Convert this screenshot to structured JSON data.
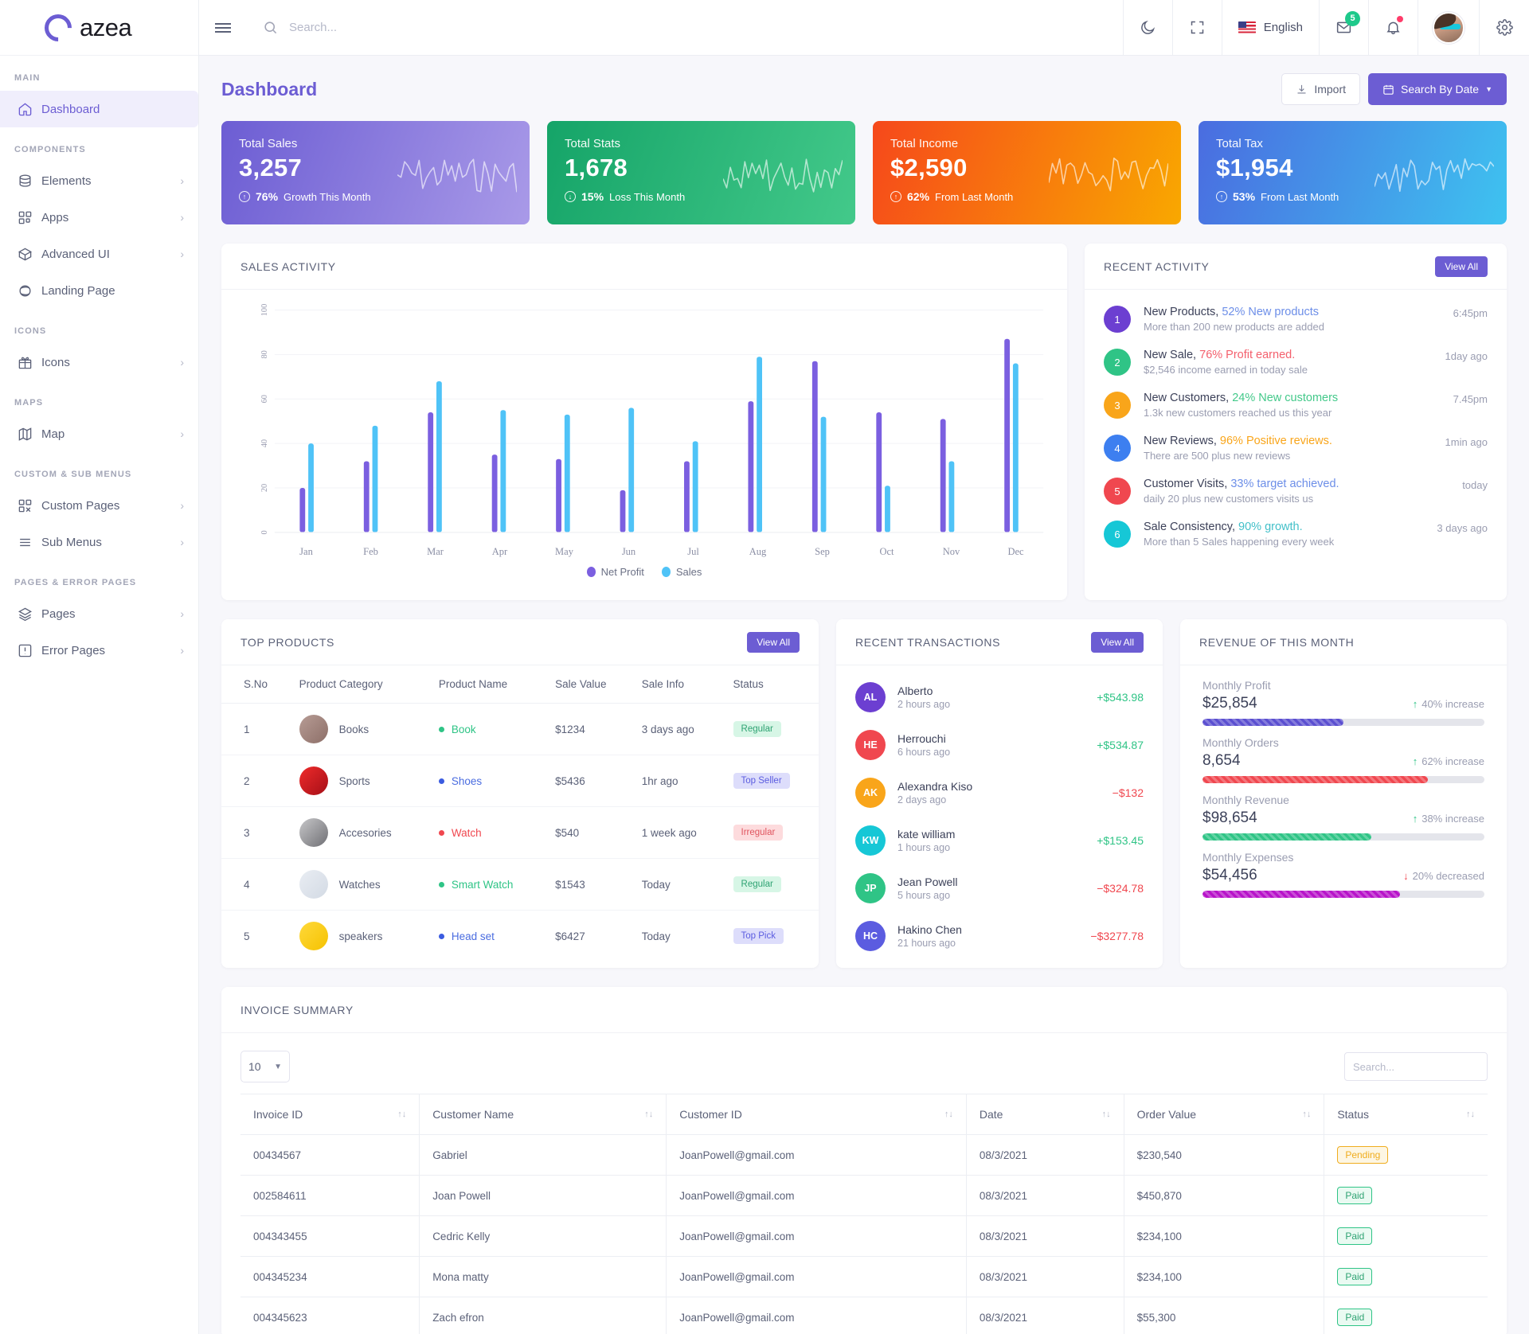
{
  "brand": {
    "name": "azea",
    "logo_icon": "azea-ring-logo"
  },
  "sidebar": {
    "sections": [
      {
        "title": "MAIN",
        "items": [
          {
            "label": "Dashboard",
            "icon": "home-icon",
            "active": true,
            "chevron": false
          }
        ]
      },
      {
        "title": "COMPONENTS",
        "items": [
          {
            "label": "Elements",
            "icon": "database-icon",
            "chevron": true
          },
          {
            "label": "Apps",
            "icon": "grid-icon",
            "chevron": true
          },
          {
            "label": "Advanced UI",
            "icon": "box-icon",
            "chevron": true
          },
          {
            "label": "Landing Page",
            "icon": "planet-icon",
            "chevron": false
          }
        ]
      },
      {
        "title": "ICONS",
        "items": [
          {
            "label": "Icons",
            "icon": "gift-icon",
            "chevron": true
          }
        ]
      },
      {
        "title": "MAPS",
        "items": [
          {
            "label": "Map",
            "icon": "map-icon",
            "chevron": true
          }
        ]
      },
      {
        "title": "CUSTOM & SUB MENUS",
        "items": [
          {
            "label": "Custom Pages",
            "icon": "custom-grid-icon",
            "chevron": true
          },
          {
            "label": "Sub Menus",
            "icon": "list-icon",
            "chevron": true
          }
        ]
      },
      {
        "title": "PAGES & ERROR PAGES",
        "items": [
          {
            "label": "Pages",
            "icon": "layers-icon",
            "chevron": true
          },
          {
            "label": "Error Pages",
            "icon": "alert-icon",
            "chevron": true
          }
        ]
      }
    ]
  },
  "topbar": {
    "search_placeholder": "Search...",
    "language": "English",
    "mail_badge": "5",
    "icons": [
      "moon-icon",
      "fullscreen-icon",
      "us-flag-icon",
      "mail-icon",
      "bell-icon",
      "avatar",
      "gear-icon"
    ]
  },
  "page": {
    "title": "Dashboard",
    "import_label": "Import",
    "search_by_date_label": "Search By Date"
  },
  "stats": [
    {
      "title": "Total Sales",
      "value": "3,257",
      "pct": "76%",
      "note": "Growth This Month",
      "dir": "up",
      "c1": "#6c5dd3",
      "c2": "#a99ae8"
    },
    {
      "title": "Total Stats",
      "value": "1,678",
      "pct": "15%",
      "note": "Loss This Month",
      "dir": "down",
      "c1": "#15a468",
      "c2": "#43c98a"
    },
    {
      "title": "Total Income",
      "value": "$2,590",
      "pct": "62%",
      "note": "From Last Month",
      "dir": "up",
      "c1": "#f6481b",
      "c2": "#f9a800"
    },
    {
      "title": "Total Tax",
      "value": "$1,954",
      "pct": "53%",
      "note": "From Last Month",
      "dir": "up",
      "c1": "#4a6ce0",
      "c2": "#3ec3f0"
    }
  ],
  "sales_activity": {
    "title": "SALES ACTIVITY"
  },
  "chart_data": {
    "type": "bar",
    "title": "SALES ACTIVITY",
    "categories": [
      "Jan",
      "Feb",
      "Mar",
      "Apr",
      "May",
      "Jun",
      "Jul",
      "Aug",
      "Sep",
      "Oct",
      "Nov",
      "Dec"
    ],
    "series": [
      {
        "name": "Net Profit",
        "color": "#7b5fe0",
        "values": [
          20,
          32,
          54,
          35,
          33,
          19,
          32,
          59,
          77,
          54,
          51,
          87
        ]
      },
      {
        "name": "Sales",
        "color": "#4fc3f7",
        "values": [
          40,
          48,
          68,
          55,
          53,
          56,
          41,
          79,
          52,
          21,
          32,
          76
        ]
      }
    ],
    "xlabel": "",
    "ylabel": "",
    "ylim": [
      0,
      100
    ],
    "yticks": [
      0,
      20,
      40,
      60,
      80,
      100
    ],
    "grid": true,
    "legend": "bottom"
  },
  "recent_activity": {
    "title": "RECENT ACTIVITY",
    "view_all": "View All",
    "items": [
      {
        "n": "1",
        "color": "#6c3fd1",
        "head": "New Products,",
        "hl": "52% New products",
        "hl_color": "#6c8ee8",
        "sub": "More than 200 new products are added",
        "time": "6:45pm"
      },
      {
        "n": "2",
        "color": "#2fc486",
        "head": "New Sale,",
        "hl": "76% Profit earned.",
        "hl_color": "#f4606d",
        "sub": "$2,546 income earned in today sale",
        "time": "1day ago"
      },
      {
        "n": "3",
        "color": "#f9a51a",
        "head": "New Customers,",
        "hl": "24% New customers",
        "hl_color": "#43c98a",
        "sub": "1.3k new customers reached us this year",
        "time": "7.45pm"
      },
      {
        "n": "4",
        "color": "#3d7ff0",
        "head": "New Reviews,",
        "hl": "96% Positive reviews.",
        "hl_color": "#f9a51a",
        "sub": "There are 500 plus new reviews",
        "time": "1min ago"
      },
      {
        "n": "5",
        "color": "#f0474f",
        "head": "Customer Visits,",
        "hl": "33% target achieved.",
        "hl_color": "#6c8ee8",
        "sub": "daily 20 plus new customers visits us",
        "time": "today"
      },
      {
        "n": "6",
        "color": "#16c7d6",
        "head": "Sale Consistency,",
        "hl": "90% growth.",
        "hl_color": "#43c0c9",
        "sub": "More than 5 Sales happening every week",
        "time": "3 days ago"
      }
    ]
  },
  "top_products": {
    "title": "TOP PRODUCTS",
    "view_all": "View All",
    "columns": [
      "S.No",
      "Product Category",
      "Product Name",
      "Sale Value",
      "Sale Info",
      "Status"
    ],
    "rows": [
      {
        "no": "1",
        "category": "Books",
        "img": "book-photo",
        "img_c1": "#b79c95",
        "img_c2": "#8d6f68",
        "name": "Book",
        "dot": "#2fc486",
        "name_color": "#2fc486",
        "value": "$1234",
        "info": "3 days ago",
        "status": "Regular",
        "status_bg": "#d7f6e6",
        "status_fg": "#2fa373"
      },
      {
        "no": "2",
        "category": "Sports",
        "img": "shoe-photo",
        "img_c1": "#ef2b2b",
        "img_c2": "#a50f17",
        "name": "Shoes",
        "dot": "#3b5ce0",
        "name_color": "#4a6ce0",
        "value": "$5436",
        "info": "1hr ago",
        "status": "Top Seller",
        "status_bg": "#ddddfb",
        "status_fg": "#5b5ce0"
      },
      {
        "no": "3",
        "category": "Accesories",
        "img": "watch-photo",
        "img_c1": "#c7c7c9",
        "img_c2": "#6f6f74",
        "name": "Watch",
        "dot": "#f0474f",
        "name_color": "#f0474f",
        "value": "$540",
        "info": "1 week ago",
        "status": "Irregular",
        "status_bg": "#fddbdd",
        "status_fg": "#e0555f"
      },
      {
        "no": "4",
        "category": "Watches",
        "img": "smartwatch-photo",
        "img_c1": "#e9edf3",
        "img_c2": "#d3dae4",
        "name": "Smart Watch",
        "dot": "#2fc486",
        "name_color": "#2fc486",
        "value": "$1543",
        "info": "Today",
        "status": "Regular",
        "status_bg": "#d7f6e6",
        "status_fg": "#2fa373"
      },
      {
        "no": "5",
        "category": "speakers",
        "img": "headset-photo",
        "img_c1": "#ffd93b",
        "img_c2": "#f5c200",
        "name": "Head set",
        "dot": "#3b5ce0",
        "name_color": "#4a6ce0",
        "value": "$6427",
        "info": "Today",
        "status": "Top Pick",
        "status_bg": "#ddddfb",
        "status_fg": "#5b5ce0"
      }
    ]
  },
  "recent_transactions": {
    "title": "RECENT TRANSACTIONS",
    "view_all": "View All",
    "items": [
      {
        "initials": "AL",
        "color": "#6c3fd1",
        "name": "Alberto",
        "ago": "2 hours ago",
        "amount": "+$543.98",
        "amount_color": "#2fc486"
      },
      {
        "initials": "HE",
        "color": "#f0474f",
        "name": "Herrouchi",
        "ago": "6 hours ago",
        "amount": "+$534.87",
        "amount_color": "#2fc486"
      },
      {
        "initials": "AK",
        "color": "#f9a51a",
        "name": "Alexandra Kiso",
        "ago": "2 days ago",
        "amount": "−$132",
        "amount_color": "#f0474f"
      },
      {
        "initials": "KW",
        "color": "#16c7d6",
        "name": "kate william",
        "ago": "1 hours ago",
        "amount": "+$153.45",
        "amount_color": "#2fc486"
      },
      {
        "initials": "JP",
        "color": "#2fc486",
        "name": "Jean Powell",
        "ago": "5 hours ago",
        "amount": "−$324.78",
        "amount_color": "#f0474f"
      },
      {
        "initials": "HC",
        "color": "#5b5ce0",
        "name": "Hakino Chen",
        "ago": "21 hours ago",
        "amount": "−$3277.78",
        "amount_color": "#f0474f"
      }
    ]
  },
  "revenue": {
    "title": "REVENUE OF THIS MONTH",
    "items": [
      {
        "label": "Monthly Profit",
        "value": "$25,854",
        "change": "40% increase",
        "dir": "up",
        "pct": 50,
        "color": "#5b4fd0"
      },
      {
        "label": "Monthly Orders",
        "value": "8,654",
        "change": "62% increase",
        "dir": "up",
        "pct": 80,
        "color": "#f0474f"
      },
      {
        "label": "Monthly Revenue",
        "value": "$98,654",
        "change": "38% increase",
        "dir": "up",
        "pct": 60,
        "color": "#2fc486"
      },
      {
        "label": "Monthly Expenses",
        "value": "$54,456",
        "change": "20% decreased",
        "dir": "down",
        "pct": 70,
        "color": "#b713c9"
      }
    ]
  },
  "invoice_summary": {
    "title": "INVOICE SUMMARY",
    "page_size": "10",
    "search_placeholder": "Search...",
    "columns": [
      "Invoice ID",
      "Customer Name",
      "Customer ID",
      "Date",
      "Order Value",
      "Status"
    ],
    "rows": [
      {
        "id": "00434567",
        "name": "Gabriel",
        "cid": "JoanPowell@gmail.com",
        "date": "08/3/2021",
        "value": "$230,540",
        "status": "Pending",
        "status_fg": "#f0ad1e",
        "status_bd": "#f0ad1e",
        "status_bg": "#fdf6e3"
      },
      {
        "id": "002584611",
        "name": "Joan Powell",
        "cid": "JoanPowell@gmail.com",
        "date": "08/3/2021",
        "value": "$450,870",
        "status": "Paid",
        "status_fg": "#2fa373",
        "status_bd": "#2fc486",
        "status_bg": "#eafaf2"
      },
      {
        "id": "004343455",
        "name": "Cedric Kelly",
        "cid": "JoanPowell@gmail.com",
        "date": "08/3/2021",
        "value": "$234,100",
        "status": "Paid",
        "status_fg": "#2fa373",
        "status_bd": "#2fc486",
        "status_bg": "#eafaf2"
      },
      {
        "id": "004345234",
        "name": "Mona matty",
        "cid": "JoanPowell@gmail.com",
        "date": "08/3/2021",
        "value": "$234,100",
        "status": "Paid",
        "status_fg": "#2fa373",
        "status_bd": "#2fc486",
        "status_bg": "#eafaf2"
      },
      {
        "id": "004345623",
        "name": "Zach efron",
        "cid": "JoanPowell@gmail.com",
        "date": "08/3/2021",
        "value": "$55,300",
        "status": "Paid",
        "status_fg": "#2fa373",
        "status_bd": "#2fc486",
        "status_bg": "#eafaf2"
      }
    ]
  }
}
